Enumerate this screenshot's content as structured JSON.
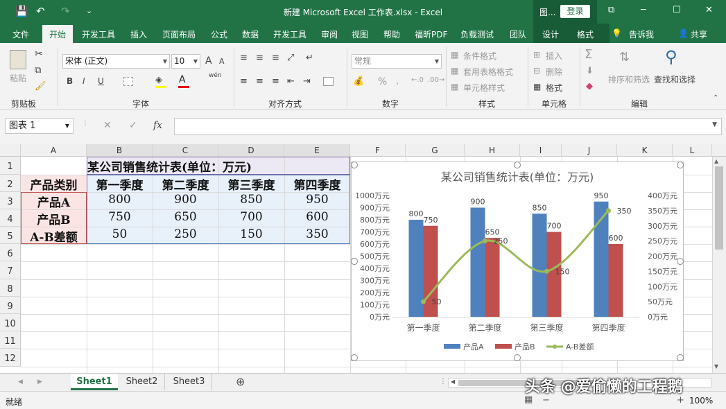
{
  "window": {
    "title": "新建 Microsoft Excel 工作表.xlsx - Excel",
    "ctx_short": "图...",
    "login": "登录",
    "min": "─",
    "restore": "⧉",
    "max": "☐",
    "close": "✕",
    "quick_save": "💾",
    "quick_undo": "↶",
    "quick_redo": "↷",
    "quick_more": "⌄"
  },
  "tabs": [
    "文件",
    "开始",
    "开发工具",
    "插入",
    "页面布局",
    "公式",
    "数据",
    "开发工具",
    "审阅",
    "视图",
    "帮助",
    "福昕PDF",
    "负载测试",
    "团队",
    "设计",
    "格式"
  ],
  "active_tab": "开始",
  "tell_me": "告诉我",
  "share": "共享",
  "ribbon": {
    "groups": [
      "剪贴板",
      "字体",
      "对齐方式",
      "数字",
      "样式",
      "单元格",
      "编辑"
    ],
    "paste": "粘贴",
    "font_name": "宋体 (正文)",
    "font_size": "10",
    "font_bold": "B",
    "font_italic": "I",
    "font_underline": "U",
    "number_format": "常规",
    "percent": "%",
    "cond_format": "条件格式",
    "table_format": "套用表格格式",
    "cell_style": "单元格样式",
    "insert": "插入",
    "delete": "删除",
    "format": "格式",
    "sort_filter": "排序和筛选",
    "find_select": "查找和选择",
    "wen": "wén"
  },
  "formula_bar": {
    "name_box": "图表 1",
    "fx": "fx",
    "cancel": "✕",
    "enter": "✓"
  },
  "columns": [
    "A",
    "B",
    "C",
    "D",
    "E",
    "F",
    "G",
    "H",
    "I",
    "J",
    "K",
    "L"
  ],
  "rows": [
    "1",
    "2",
    "3",
    "4",
    "5",
    "6",
    "7",
    "8",
    "9",
    "10",
    "11",
    "12"
  ],
  "sheet": {
    "title": "某公司销售统计表(单位：万元)",
    "headers": [
      "产品类别",
      "第一季度",
      "第二季度",
      "第三季度",
      "第四季度"
    ],
    "data": [
      [
        "产品A",
        "800",
        "900",
        "850",
        "950"
      ],
      [
        "产品B",
        "750",
        "650",
        "700",
        "600"
      ],
      [
        "A-B差额",
        "50",
        "250",
        "150",
        "350"
      ]
    ]
  },
  "sheets": [
    "Sheet1",
    "Sheet2",
    "Sheet3"
  ],
  "active_sheet": "Sheet1",
  "status": {
    "ready": "就绪",
    "zoom": "100%",
    "watermark": "头条 @爱偷懒的工程鹅"
  },
  "colors": {
    "excel_green": "#217346",
    "series_a": "#4f81bd",
    "series_b": "#c0504d",
    "series_c": "#9bbb59"
  },
  "chart_data": {
    "type": "bar",
    "title": "某公司销售统计表(单位：万元)",
    "categories": [
      "第一季度",
      "第二季度",
      "第三季度",
      "第四季度"
    ],
    "series": [
      {
        "name": "产品A",
        "type": "bar",
        "axis": "left",
        "values": [
          800,
          900,
          850,
          950
        ],
        "color": "#4f81bd"
      },
      {
        "name": "产品B",
        "type": "bar",
        "axis": "left",
        "values": [
          750,
          650,
          700,
          600
        ],
        "color": "#c0504d"
      },
      {
        "name": "A-B差额",
        "type": "line",
        "smooth": true,
        "axis": "right",
        "values": [
          50,
          250,
          150,
          350
        ],
        "color": "#9bbb59"
      }
    ],
    "y_left": {
      "min": 0,
      "max": 1000,
      "step": 100,
      "ticks": [
        "0万元",
        "100万元",
        "200万元",
        "300万元",
        "400万元",
        "500万元",
        "600万元",
        "700万元",
        "800万元",
        "900万元",
        "1000万元"
      ]
    },
    "y_right": {
      "min": 0,
      "max": 400,
      "step": 50,
      "ticks": [
        "0万元",
        "50万元",
        "100万元",
        "150万元",
        "200万元",
        "250万元",
        "300万元",
        "350万元",
        "400万元"
      ]
    },
    "grid": false,
    "legend": "bottom"
  }
}
